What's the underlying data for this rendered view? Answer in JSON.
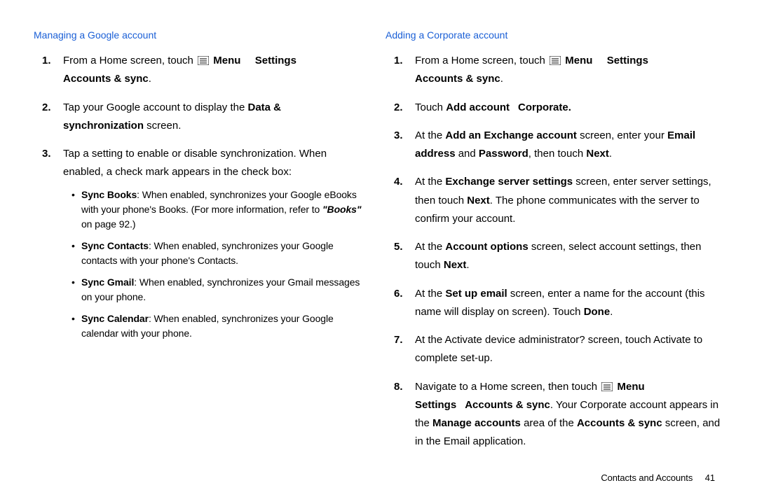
{
  "left": {
    "title": "Managing a Google account",
    "steps": {
      "s1_a": "From a Home screen, touch ",
      "s1_menu": " Menu",
      "s1_b": "Settings",
      "s1_c": "Accounts & sync",
      "s1_d": ".",
      "s2_a": "Tap your Google account to display the ",
      "s2_b": "Data & synchronization",
      "s2_c": " screen.",
      "s3_a": "Tap a setting to enable or disable synchronization. When enabled, a check mark appears in the check box:",
      "b1_a": "Sync Books",
      "b1_b": ": When enabled, synchronizes your Google eBooks with your phone's Books. (For more information, refer to ",
      "b1_c": "\"Books\"",
      "b1_d": " on page 92.)",
      "b2_a": "Sync Contacts",
      "b2_b": ": When enabled, synchronizes your Google contacts with your phone's Contacts.",
      "b3_a": "Sync Gmail",
      "b3_b": ": When enabled, synchronizes your Gmail messages on your phone.",
      "b4_a": "Sync Calendar",
      "b4_b": ": When enabled, synchronizes your Google calendar with your phone."
    }
  },
  "right": {
    "title": "Adding a Corporate account",
    "steps": {
      "s1_a": "From a Home screen, touch ",
      "s1_menu": " Menu",
      "s1_b": "Settings",
      "s1_c": "Accounts & sync",
      "s1_d": ".",
      "s2_a": "Touch ",
      "s2_b": "Add account",
      "s2_c": "Corporate.",
      "s3_a": "At the ",
      "s3_b": "Add an Exchange account",
      "s3_c": " screen, enter your ",
      "s3_d": "Email address",
      "s3_e": " and ",
      "s3_f": "Password",
      "s3_g": ", then touch ",
      "s3_h": "Next",
      "s3_i": ".",
      "s4_a": "At the ",
      "s4_b": "Exchange server settings",
      "s4_c": " screen, enter server settings, then touch ",
      "s4_d": "Next",
      "s4_e": ". The phone communicates with the server to confirm your account.",
      "s5_a": "At the ",
      "s5_b": "Account options",
      "s5_c": " screen, select account settings, then touch ",
      "s5_d": "Next",
      "s5_e": ".",
      "s6_a": "At the ",
      "s6_b": "Set up email",
      "s6_c": " screen, enter a name for the account (this name will display on screen). Touch ",
      "s6_d": "Done",
      "s6_e": ".",
      "s7_a": "At the Activate device administrator? screen, touch Activate to complete set-up.",
      "s8_a": "Navigate to a Home screen, then touch ",
      "s8_menu": " Menu",
      "s8_b": "Settings",
      "s8_c": "Accounts & sync",
      "s8_d": ". Your Corporate account appears in the ",
      "s8_e": "Manage accounts",
      "s8_f": " area of the ",
      "s8_g": "Accounts & sync",
      "s8_h": " screen, and in the Email application."
    }
  },
  "footer": {
    "text": "Contacts and Accounts",
    "page": "41"
  }
}
